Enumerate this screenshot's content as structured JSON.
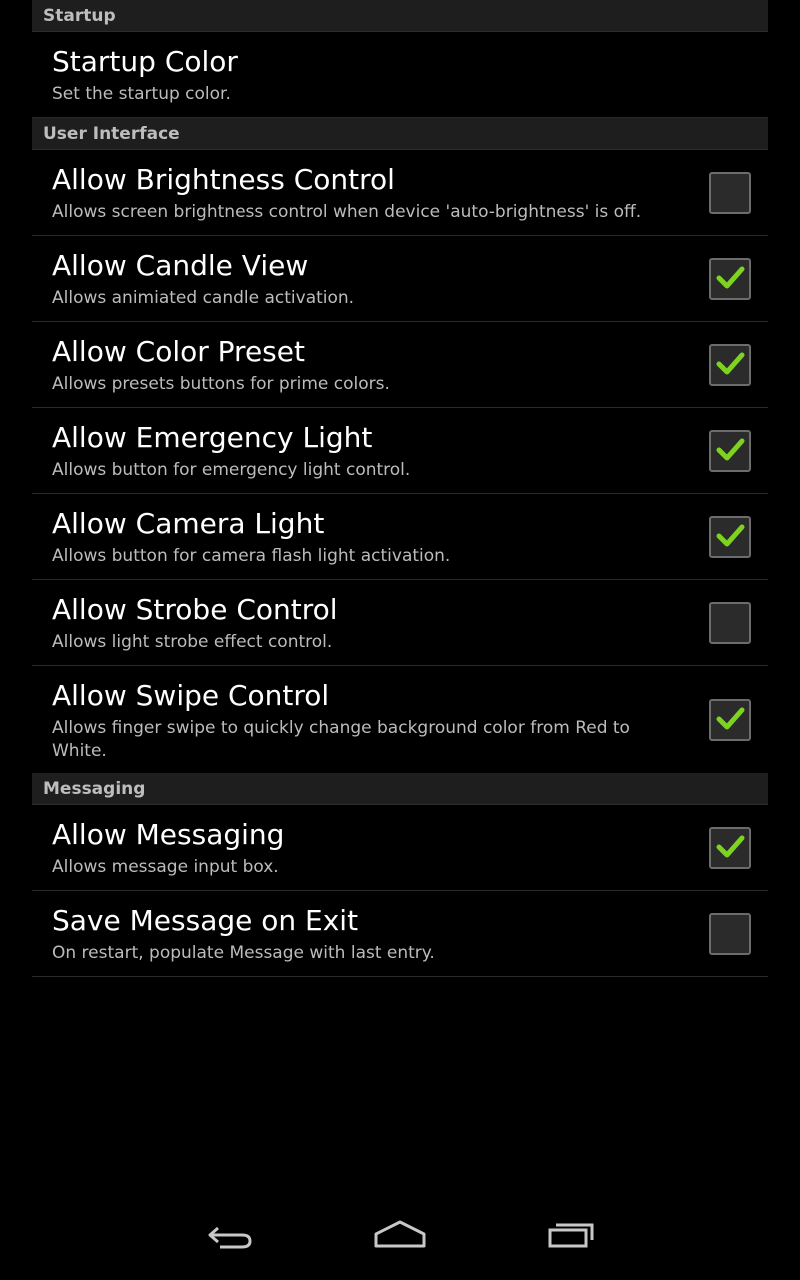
{
  "colors": {
    "check": "#7ed321",
    "section_bg": "#1e1e1e",
    "summary_text": "#bcbcbc"
  },
  "sections": [
    {
      "header": "Startup",
      "items": [
        {
          "title": "Startup Color",
          "summary": "Set the startup color.",
          "has_checkbox": false
        }
      ]
    },
    {
      "header": "User Interface",
      "items": [
        {
          "title": "Allow Brightness Control",
          "summary": "Allows screen brightness control when device 'auto-brightness' is off.",
          "checked": false
        },
        {
          "title": "Allow Candle View",
          "summary": "Allows animiated candle activation.",
          "checked": true
        },
        {
          "title": "Allow Color Preset",
          "summary": "Allows presets buttons for prime colors.",
          "checked": true
        },
        {
          "title": "Allow Emergency Light",
          "summary": "Allows button for emergency light control.",
          "checked": true
        },
        {
          "title": "Allow Camera Light",
          "summary": "Allows button for camera flash light activation.",
          "checked": true
        },
        {
          "title": "Allow Strobe Control",
          "summary": "Allows light strobe effect control.",
          "checked": false
        },
        {
          "title": "Allow Swipe Control",
          "summary": "Allows finger swipe to quickly change background color from Red to White.",
          "checked": true
        }
      ]
    },
    {
      "header": "Messaging",
      "items": [
        {
          "title": "Allow Messaging",
          "summary": "Allows message input box.",
          "checked": true
        },
        {
          "title": "Save Message on Exit",
          "summary": "On restart, populate Message with last entry.",
          "checked": false
        }
      ]
    }
  ],
  "navbar": {
    "back": "back-icon",
    "home": "home-icon",
    "recents": "recents-icon"
  }
}
